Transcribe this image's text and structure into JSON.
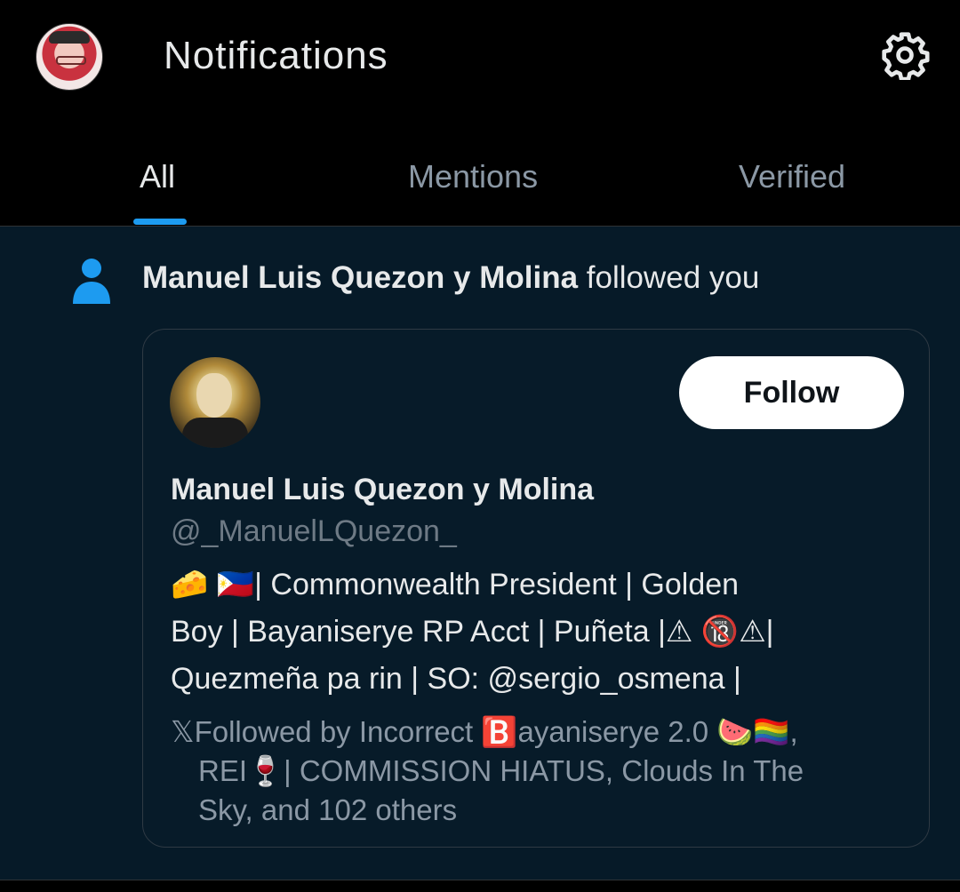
{
  "header": {
    "title": "Notifications",
    "tabs": [
      {
        "label": "All",
        "active": true
      },
      {
        "label": "Mentions",
        "active": false
      },
      {
        "label": "Verified",
        "active": false
      }
    ],
    "accent_color": "#1d9bf0",
    "settings_icon": "gear-icon"
  },
  "notification": {
    "type_icon": "person-icon",
    "actor_name": "Manuel Luis Quezon y Molina",
    "action_text": " followed you",
    "card": {
      "display_name": "Manuel Luis Quezon y Molina",
      "handle": "@_ManuelLQuezon_",
      "follow_label": "Follow",
      "bio_lines": [
        "🧀 🇵🇭| Commonwealth President | Golden",
        "Boy | Bayaniserye RP Acct | Puñeta |⚠ 🔞⚠|",
        "Quezmeña pa rin | SO: @sergio_osmena |"
      ],
      "followed_by_lines": [
        "𝕏Followed by Incorrect 🅱️ayaniserye 2.0 🍉🏳️‍🌈,",
        "REI🍷| COMMISSION HIATUS, Clouds In The",
        "Sky, and 102 others"
      ]
    }
  }
}
